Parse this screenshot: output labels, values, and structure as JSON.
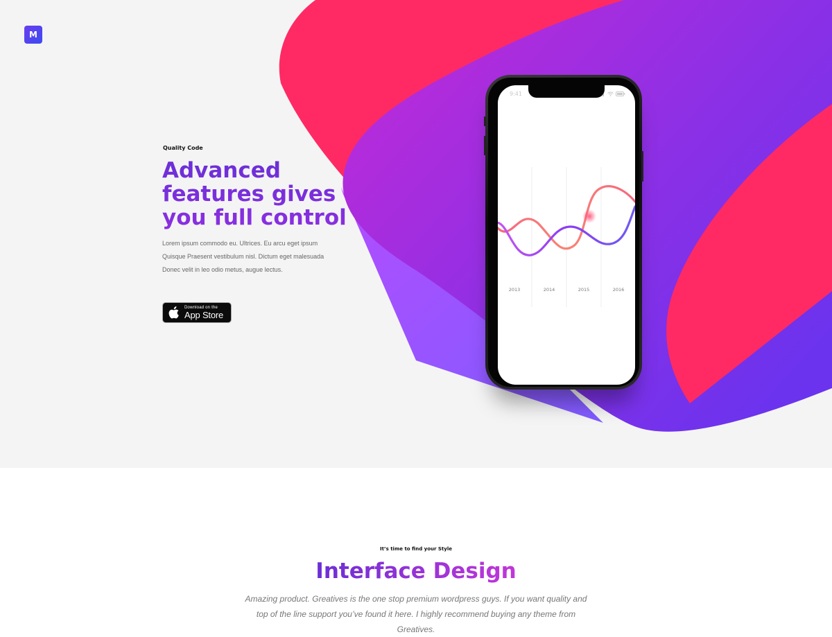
{
  "brand": {
    "logo_letter": "M"
  },
  "hero": {
    "eyebrow": "Quality Code",
    "headline": "Advanced features gives you full control",
    "lead": "Lorem ipsum commodo eu. Ultrices. Eu arcu eget ipsum Quisque Praesent vestibulum nisl. Dictum eget malesuada Donec velit in leo odio metus, augue lectus.",
    "app_store": {
      "line1": "Download on the",
      "line2": "App Store"
    },
    "colors": {
      "pink": "#ff2a63",
      "purple": "#8a32f0",
      "violet": "#6a2fd6"
    }
  },
  "phone": {
    "status_time": "9:41",
    "chart_data": {
      "type": "line",
      "categories": [
        "2013",
        "2014",
        "2015",
        "2016"
      ],
      "series": [
        {
          "color": "#f7657f"
        },
        {
          "color": "#9b45ea"
        }
      ]
    }
  },
  "section2": {
    "eyebrow": "It’s time to find your Style",
    "title": "Interface Design",
    "description": "Amazing product. Greatives is the one stop premium wordpress guys. If you want quality and top of the line support you’ve found it here. I highly recommend buying any theme from Greatives."
  }
}
